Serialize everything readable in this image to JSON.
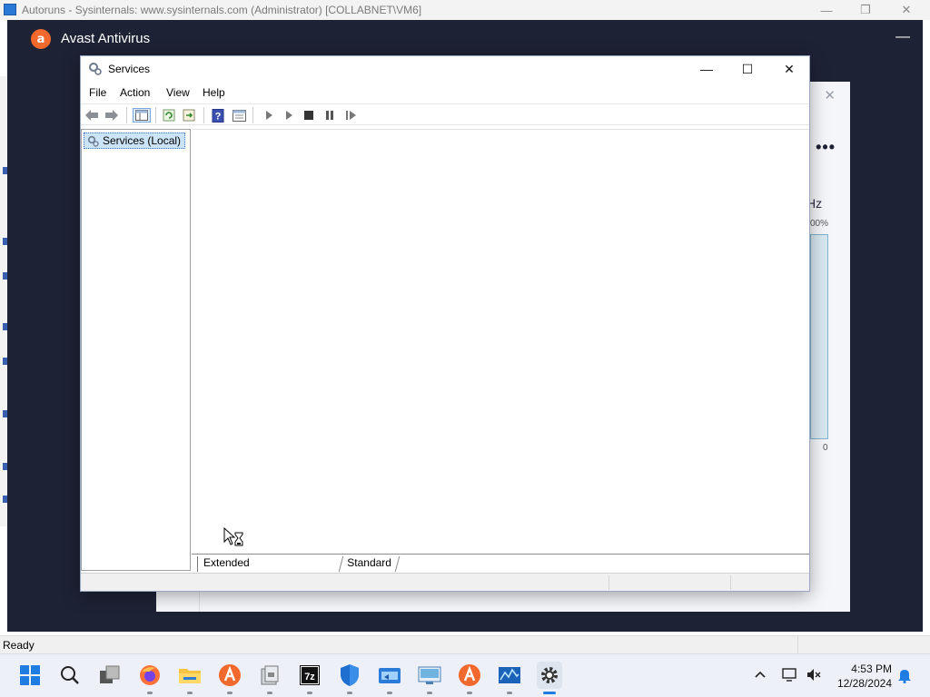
{
  "autoruns": {
    "title": "Autoruns - Sysinternals: www.sysinternals.com (Administrator) [COLLABNET\\VM6]",
    "status": "Ready",
    "minimize_glyph": "—",
    "maximize_glyph": "❐",
    "close_glyph": "✕"
  },
  "avast": {
    "title": "Avast Antivirus",
    "logo_letter": "a",
    "minimize_glyph": "—",
    "close_glyph": "✕",
    "more_glyph": "•••",
    "cpu_unit_partial": "Hz",
    "graph_top_label": "00%",
    "graph_bottom_label": "0",
    "brand_color": "#f1692d"
  },
  "services": {
    "title": "Services",
    "minimize_glyph": "—",
    "maximize_glyph": "☐",
    "close_glyph": "✕",
    "menu": {
      "file": "File",
      "action": "Action",
      "view": "View",
      "help": "Help"
    },
    "toolbar_icons": [
      "back-arrow-icon",
      "forward-arrow-icon",
      "show-hide-console-tree-icon",
      "refresh-icon",
      "export-list-icon",
      "help-icon",
      "properties-icon",
      "start-service-icon",
      "start-service-alt-icon",
      "stop-service-icon",
      "pause-service-icon",
      "resume-service-icon"
    ],
    "tree": {
      "root_label": "Services (Local)"
    },
    "tabs": {
      "extended": "Extended",
      "standard": "Standard"
    }
  },
  "taskbar": {
    "apps": [
      "start-icon",
      "search-icon",
      "task-view-icon",
      "firefox-icon",
      "file-explorer-icon",
      "avast-icon",
      "archive-tool-icon",
      "7zip-icon",
      "defender-icon",
      "remote-desktop-icon",
      "network-monitor-icon",
      "avast-secondary-icon",
      "performance-monitor-icon",
      "services-settings-icon"
    ],
    "clock_time": "4:53 PM",
    "clock_date": "12/28/2024"
  }
}
